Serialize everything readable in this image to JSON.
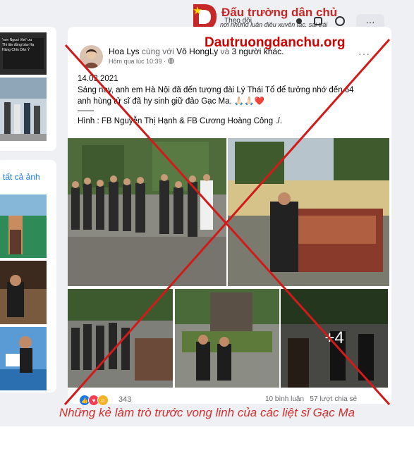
{
  "left_sidebar": {
    "see_all_photos": "tất cả ảnh",
    "tile_texts": [
      "'non Nguoi Viet' ưu",
      "Thi tân đồng bào Hạ",
      "Hàng Chín Dân Ý"
    ]
  },
  "header": {
    "follow_label": "Theo dõi",
    "more_label": "···"
  },
  "watermark": {
    "brand_title": "Đấu trường dân chủ",
    "brand_slogan": "nơi những luận điệu xuyên tạc, sai trái",
    "site_url": "Dautruongdanchu.org"
  },
  "post": {
    "author": "Hoa Lys",
    "with_word": "cùng với",
    "tagged": "Võ HongLy",
    "and_word": "và",
    "others": "3 người khác.",
    "timestamp": "Hôm qua lúc 10:39 ·",
    "privacy_icon": "globe-icon",
    "date_line": "14.03.2021",
    "body_line1": "Sáng nay, anh em Hà Nội đã đến tượng đài Lý Thái Tổ để tưởng nhớ đến 64",
    "body_line2": "anh hùng tử sĩ đã hy sinh giữ đảo Gạc Ma. 🙏🏻🙏🏻❤️",
    "separator": "——",
    "credit_line": "Hình :  FB Nguyễn Thị Hạnh & FB Cương Hoàng Công ./.",
    "more_photos": "+4",
    "reaction_count": "343",
    "comment_count": "10 bình luận",
    "share_count": "57 lượt chia sẻ"
  },
  "caption": "Những kẻ làm trò trước vong linh của các liệt sĩ Gạc Ma",
  "colors": {
    "cross": "#d11a1a",
    "caption": "#d32f2f",
    "link": "#1877f2",
    "brand_red": "#c62828"
  }
}
